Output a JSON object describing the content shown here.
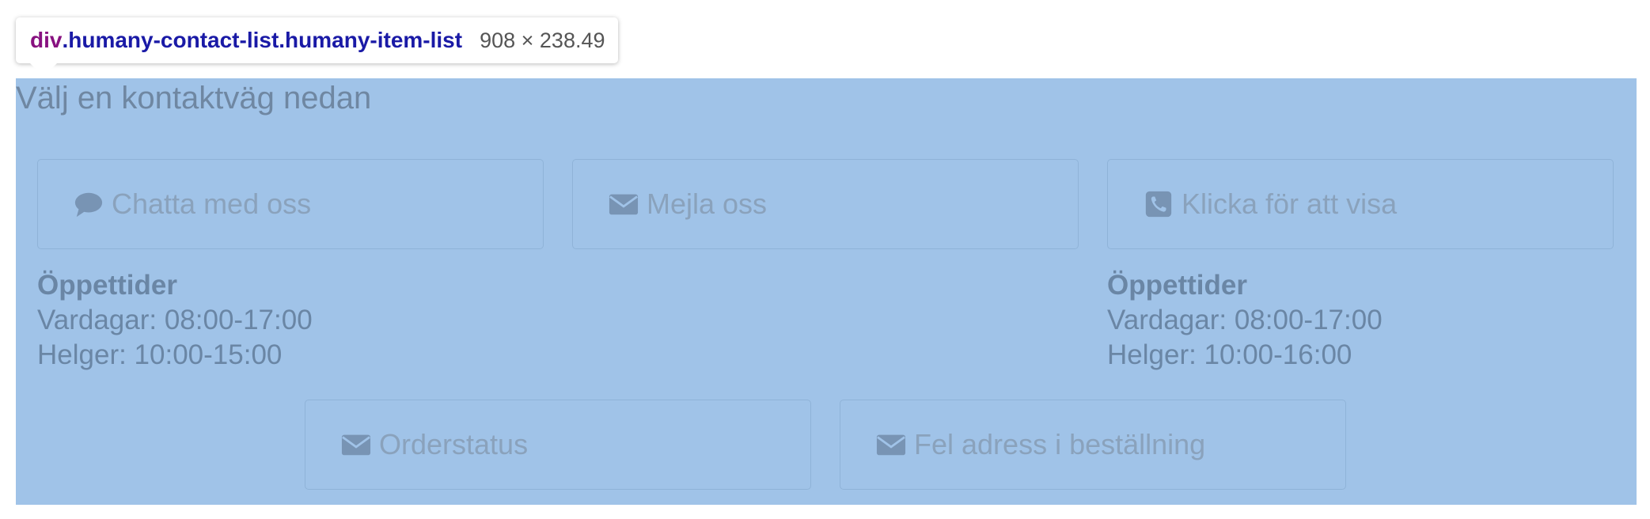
{
  "tooltip": {
    "tag": "div",
    "classes": ".humany-contact-list.humany-item-list",
    "size": "908 × 238.49"
  },
  "heading": "Välj en kontaktväg nedan",
  "contacts": [
    {
      "label": "Chatta med oss",
      "icon": "chat-bubble-icon"
    },
    {
      "label": "Mejla oss",
      "icon": "envelope-icon"
    },
    {
      "label": "Klicka för att visa",
      "icon": "phone-icon"
    },
    {
      "label": "Orderstatus",
      "icon": "envelope-icon"
    },
    {
      "label": "Fel adress i beställning",
      "icon": "envelope-icon"
    }
  ],
  "hours": [
    {
      "title": "Öppettider",
      "weekdays": "Vardagar: 08:00-17:00",
      "weekends": "Helger: 10:00-15:00"
    },
    {
      "title": "Öppettider",
      "weekdays": "Vardagar: 08:00-17:00",
      "weekends": "Helger: 10:00-16:00"
    }
  ],
  "colors": {
    "highlight": "#a0c3e8",
    "icon": "#7894b4",
    "label": "#8aa2bc"
  }
}
